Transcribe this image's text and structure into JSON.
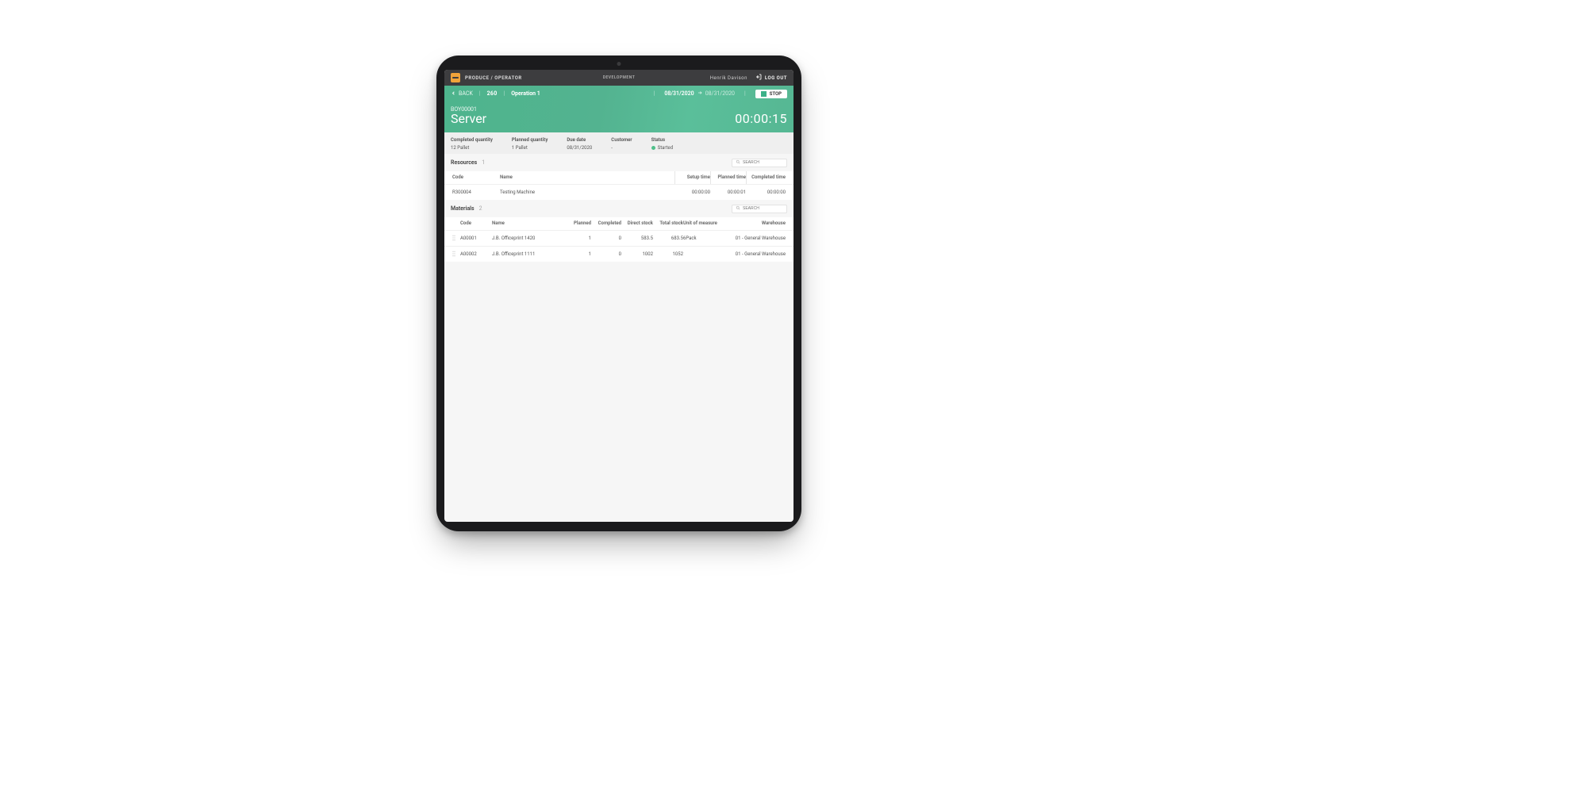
{
  "topbar": {
    "brand": "PRODUCE / OPERATOR",
    "environment": "DEVELOPMENT",
    "user": "Henrik Davison",
    "logout_label": "LOG OUT"
  },
  "header": {
    "back_label": "BACK",
    "order_number": "260",
    "operation_name": "Operation 1",
    "date_from": "08/31/2020",
    "date_to": "08/31/2020",
    "stop_label": "STOP",
    "item_code": "BOY00001",
    "item_name": "Server",
    "elapsed_timer": "00:00:15"
  },
  "info": {
    "completed_qty_label": "Completed quantity",
    "completed_qty_value": "12 Pallet",
    "planned_qty_label": "Planned quantity",
    "planned_qty_value": "1 Pallet",
    "due_date_label": "Due date",
    "due_date_value": "08/31/2020",
    "customer_label": "Customer",
    "customer_value": "-",
    "status_label": "Status",
    "status_value": "Started"
  },
  "resources_section": {
    "title": "Resources",
    "count": "1",
    "search_placeholder": "SEARCH",
    "columns": {
      "code": "Code",
      "name": "Name",
      "setup_time": "Setup time",
      "planned_time": "Planned time",
      "completed_time": "Completed time"
    },
    "rows": [
      {
        "code": "R300004",
        "name": "Testing Machine",
        "setup_time": "00:00:00",
        "planned_time": "00:00:01",
        "completed_time": "00:00:00"
      }
    ]
  },
  "materials_section": {
    "title": "Materials",
    "count": "2",
    "search_placeholder": "SEARCH",
    "columns": {
      "code": "Code",
      "name": "Name",
      "planned": "Planned",
      "completed": "Completed",
      "direct_stock": "Direct stock",
      "total_stock": "Total stock",
      "uom": "Unit of measure",
      "warehouse": "Warehouse"
    },
    "rows": [
      {
        "code": "A00001",
        "name": "J.B. Officeprint 1420",
        "planned": "1",
        "completed": "0",
        "direct_stock": "583.5",
        "total_stock": "683.5",
        "uom": "6Pack",
        "warehouse": "01 - General Warehouse"
      },
      {
        "code": "A00002",
        "name": "J.B. Officeprint 1111",
        "planned": "1",
        "completed": "0",
        "direct_stock": "1002",
        "total_stock": "1052",
        "uom": "",
        "warehouse": "01 - General Warehouse"
      }
    ]
  }
}
